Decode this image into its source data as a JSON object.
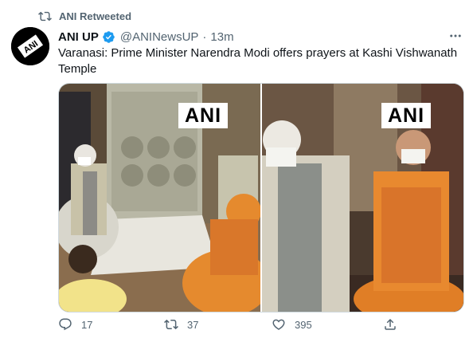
{
  "retweet": {
    "label": "ANI Retweeted",
    "icon": "retweet-icon"
  },
  "author": {
    "name": "ANI UP",
    "handle": "@ANINewsUP",
    "separator": "·",
    "time": "13m",
    "verified": true,
    "avatar_text": "ANI"
  },
  "tweet": {
    "text": "Varanasi: Prime Minister Narendra Modi offers prayers at Kashi Vishwanath Temple"
  },
  "media": [
    {
      "watermark": "ANI"
    },
    {
      "watermark": "ANI"
    }
  ],
  "actions": {
    "reply_count": "17",
    "retweet_count": "37",
    "like_count": "395"
  },
  "colors": {
    "secondary_text": "#536471",
    "verified_blue": "#1d9bf0",
    "saffron": "#e58a2e"
  }
}
